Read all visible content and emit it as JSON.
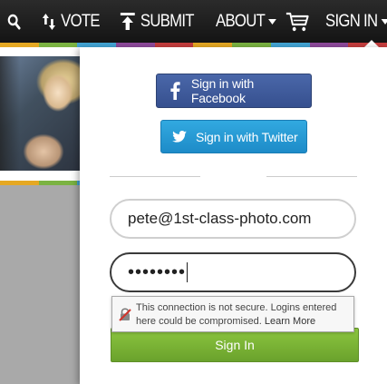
{
  "nav": {
    "vote": "VOTE",
    "submit": "SUBMIT",
    "about": "ABOUT",
    "sign_in": "SIGN IN"
  },
  "icons": {
    "search": "search-icon",
    "vote": "vote-arrows-icon",
    "submit": "upload-icon",
    "cart": "cart-icon",
    "facebook": "facebook-icon",
    "twitter": "twitter-icon",
    "insecure_lock": "insecure-lock-icon"
  },
  "colors": {
    "stripe": [
      "#e5a823",
      "#7bb342",
      "#43a5d5",
      "#8e4a9b",
      "#c53e3e",
      "#e5a823",
      "#7bb342",
      "#43a5d5",
      "#8e4a9b",
      "#c53e3e"
    ],
    "facebook": "#3b5998",
    "twitter": "#1da1f2",
    "sign_in_button": "#7cb342"
  },
  "login": {
    "facebook_label": "Sign in with Facebook",
    "twitter_label": "Sign in with Twitter",
    "email_value": "pete@1st-class-photo.com",
    "password_value": "••••••••",
    "sign_in_label": "Sign In"
  },
  "warning": {
    "text": "This connection is not secure. Logins entered here could be compromised.",
    "learn_more": "Learn More"
  }
}
